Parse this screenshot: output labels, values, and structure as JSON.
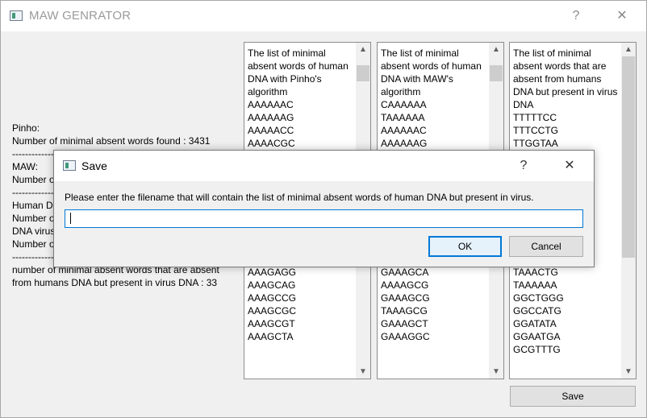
{
  "window": {
    "title": "MAW GENRATOR",
    "help_glyph": "?",
    "close_glyph": "✕"
  },
  "main": {
    "lines": [
      "Pinho:",
      "Number of minimal absent words found : 3431",
      "-----------------------------------------------------------",
      "MAW:",
      "Number of minimal absent words found",
      "-----------------------------------------------------------",
      "Human DNA",
      "Number of minimal absent words found",
      "DNA virus",
      "Number of minimal absent words found",
      "-----------------------------------------------------------",
      "number of minimal absent words that are absent",
      " from humans DNA but present in virus DNA : 33"
    ],
    "save_label": "Save"
  },
  "lists": [
    {
      "header": "The list of minimal absent words of human DNA with Pinho's algorithm",
      "items": [
        "AAAAAAC",
        "AAAAAAG",
        "AAAAACC",
        "AAAACGC",
        "",
        "",
        "",
        "",
        "",
        "",
        "AAACGTC",
        "AAACTCT",
        "AAAGACG",
        "AAAGAGG",
        "AAAGCAG",
        "AAAGCCG",
        "AAAGCGC",
        "AAAGCGT",
        "AAAGCTA"
      ],
      "scroll_fraction": 0.03
    },
    {
      "header": "The list of minimal absent words of human DNA with MAW's algorithm",
      "items": [
        "CAAAAAA",
        "TAAAAAA",
        "AAAAAAC",
        "AAAAAAG",
        "",
        "",
        "",
        "",
        "",
        "",
        "GAAACGT",
        "TAAACTG",
        "GAAAGAT",
        "GAAAGCA",
        "AAAAGCG",
        "GAAAGCG",
        "TAAAGCG",
        "GAAAGCT",
        "GAAAGGC"
      ],
      "scroll_fraction": 0.03
    },
    {
      "header": "The list of minimal absent words that are absent from humans DNA but present in virus DNA",
      "items": [
        "TTTTTCC",
        "TTTCCTG",
        "TTGGTAA",
        "",
        "",
        "",
        "",
        "",
        "",
        "",
        "TAATTAA",
        "TAAGAAT",
        "TAAACTG",
        "TAAAAAA",
        "GGCTGGG",
        "GGCCATG",
        "GGATATA",
        "GGAATGA",
        "GCGTTTG"
      ],
      "scroll_fraction": 0.0
    }
  ],
  "dialog": {
    "title": "Save",
    "help_glyph": "?",
    "close_glyph": "✕",
    "message": "Please enter the filename that will contain the list of minimal absent words  of  human DNA but present in virus.",
    "input_value": "",
    "ok_label": "OK",
    "cancel_label": "Cancel"
  }
}
